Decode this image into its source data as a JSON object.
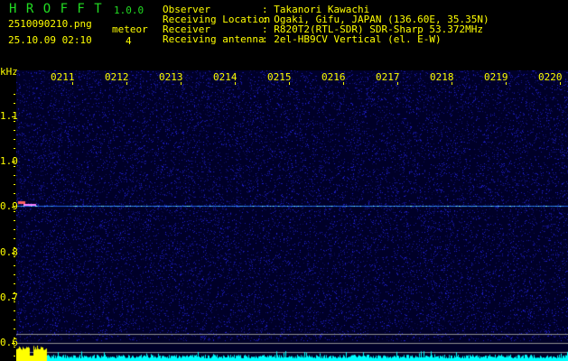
{
  "app": {
    "logo": "H R O F F T",
    "version": "1.0.0"
  },
  "file": {
    "name": "2510090210.png",
    "datetime": "25.10.09 02:10"
  },
  "meteor": {
    "label": "meteor",
    "count": "4"
  },
  "info": [
    {
      "label": "Observer",
      "value": ": Takanori Kawachi"
    },
    {
      "label": "Receiving Location",
      "value": ": Ogaki, Gifu, JAPAN (136.60E, 35.35N)"
    },
    {
      "label": "Receiver",
      "value": ": R820T2(RTL-SDR) SDR-Sharp 53.372MHz"
    },
    {
      "label": "Receiving antenna",
      "value": ": 2el-HB9CV Vertical (el. E-W)"
    }
  ],
  "axis": {
    "unit": "kHz",
    "freq_labels": [
      "1.1",
      "1.0",
      "0.9",
      "0.8",
      "0.7",
      "0.6"
    ],
    "time_labels": [
      "0211",
      "0212",
      "0213",
      "0214",
      "0215",
      "0216",
      "0217",
      "0218",
      "0219",
      "0220"
    ]
  },
  "colors": {
    "text": "#ffff00",
    "logo": "#22dd22",
    "background": "#000033",
    "noise": "#2020c0",
    "signal": "#00ffff",
    "level_high": "#ffff00"
  }
}
